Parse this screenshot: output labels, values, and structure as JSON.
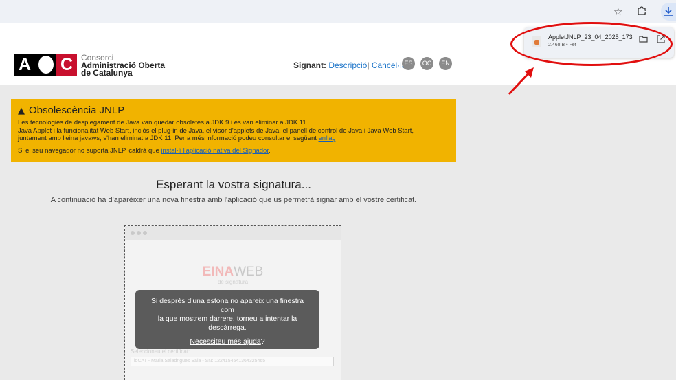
{
  "browser": {
    "icons": [
      "star-icon",
      "extensions-icon",
      "download-icon"
    ]
  },
  "download": {
    "filename": "AppletJNLP_23_04_2025_173",
    "meta": "2.468 B • Fet"
  },
  "header": {
    "org_line1": "Consorci",
    "org_line2": "Administració Oberta",
    "org_line3": "de Catalunya",
    "signant_label": "Signant:",
    "descripcio": "Descripció",
    "separator": "|",
    "cancel": "Cancel·la",
    "langs": [
      "ES",
      "OC",
      "EN"
    ]
  },
  "warning": {
    "title": "Obsolescència JNLP",
    "p1": "Les tecnologies de desplegament de Java van quedar obsoletes a JDK 9 i es van eliminar a JDK 11.",
    "p2": "Java Applet i la funcionalitat Web Start, inclòs el plug-in de Java, el visor d'applets de Java, el panell de control de Java i Java Web Start,",
    "p3": "juntament amb l'eina javaws, s'han eliminat a JDK 11. Per a més informació podeu consultar el següent ",
    "p3_link": "enllaç",
    "p4": "Si el seu navegador no suporta JNLP, caldrà que ",
    "p4_link": "instal·li l'aplicació nativa del Signador",
    "p4_end": "."
  },
  "main": {
    "title": "Esperant la vostra signatura...",
    "subtitle": "A continuació ha d'aparèixer una nova finestra amb l'aplicació que us permetrà signar amb el vostre certificat."
  },
  "applet": {
    "brand_bold": "EINA",
    "brand_rest": "WEB",
    "brand_sub": "de signatura",
    "select_label": "Seleccioneu el certificat:",
    "select_value": "idCAT - Maria Saladrigues Sala - SN: 1224154541364325465"
  },
  "overlay": {
    "line1": "Si després d'una estona no apareix una finestra com",
    "line2": "la que mostrem darrere, ",
    "retry_link": "torneu a intentar la descàrrega",
    "line2_end": ".",
    "help_link": "Necessiteu més ajuda",
    "help_end": "?"
  },
  "colors": {
    "warning_bg": "#f1b300",
    "highlight": "#e10f0f",
    "link": "#1a73c8",
    "brand_red": "#c8102e"
  }
}
